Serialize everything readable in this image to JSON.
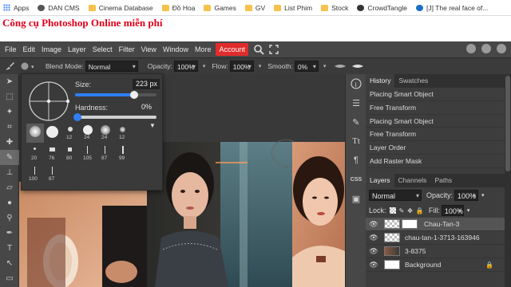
{
  "bookmarks": [
    {
      "label": "Apps",
      "icon": "apps-grid-icon",
      "color": "#4285f4"
    },
    {
      "label": "DAN CMS",
      "icon": "site-favicon-icon",
      "color": "#555555"
    },
    {
      "label": "Cinema Database",
      "icon": "folder-icon",
      "color": "#f4c24d"
    },
    {
      "label": "Đồ Hoạ",
      "icon": "folder-icon",
      "color": "#f4c24d"
    },
    {
      "label": "Games",
      "icon": "folder-icon",
      "color": "#f4c24d"
    },
    {
      "label": "GV",
      "icon": "folder-icon",
      "color": "#f4c24d"
    },
    {
      "label": "List Phim",
      "icon": "folder-icon",
      "color": "#f4c24d"
    },
    {
      "label": "Stock",
      "icon": "folder-icon",
      "color": "#f4c24d"
    },
    {
      "label": "CrowdTangle",
      "icon": "crowdtangle-icon",
      "color": "#333333"
    },
    {
      "label": "[J] The real face of...",
      "icon": "site-favicon-icon",
      "color": "#1b6ec2"
    }
  ],
  "site_title": "Công cụ Photoshop Online miễn phí",
  "menu": [
    "File",
    "Edit",
    "Image",
    "Layer",
    "Select",
    "Filter",
    "View",
    "Window",
    "More"
  ],
  "account_label": "Account",
  "accent_color": "#e12c2c",
  "options": {
    "blend_label": "Blend Mode:",
    "blend_value": "Normal",
    "opacity_label": "Opacity:",
    "opacity_value": "100%",
    "flow_label": "Flow:",
    "flow_value": "100%",
    "smooth_label": "Smooth:",
    "smooth_value": "0%"
  },
  "brush_popup": {
    "size_label": "Size:",
    "size_value": "223",
    "size_unit": "px",
    "size_fraction": 0.73,
    "hardness_label": "Hardness:",
    "hardness_value": "0%",
    "hardness_fraction": 0.0,
    "presets_row1": [
      "",
      "",
      "12",
      "24",
      "24",
      "12"
    ],
    "presets_row2": [
      "20",
      "76",
      "80",
      "105",
      "87",
      "99"
    ],
    "presets_row3": [
      "100",
      "87"
    ]
  },
  "history": {
    "tabs": [
      "History",
      "Swatches"
    ],
    "items": [
      "Placing Smart Object",
      "Free Transform",
      "Placing Smart Object",
      "Free Transform",
      "Layer Order",
      "Add Raster Mask"
    ]
  },
  "layers": {
    "tabs": [
      "Layers",
      "Channels",
      "Paths"
    ],
    "blend_value": "Normal",
    "opacity_label": "Opacity:",
    "opacity_value": "100%",
    "lock_label": "Lock:",
    "fill_label": "Fill:",
    "fill_value": "100%",
    "items": [
      {
        "name": "Chau-Tan-3",
        "selected": true
      },
      {
        "name": "chau-tan-1-3713-163946",
        "selected": false
      },
      {
        "name": "3-8375",
        "selected": false
      },
      {
        "name": "Background",
        "selected": false
      }
    ]
  },
  "mini_panel_buttons": [
    "info-icon",
    "properties-icon",
    "brush-settings-icon",
    "character-icon",
    "paragraph-icon",
    "css-icon",
    "image-icon"
  ],
  "mini_panel_labels": {
    "css": "CSS"
  }
}
